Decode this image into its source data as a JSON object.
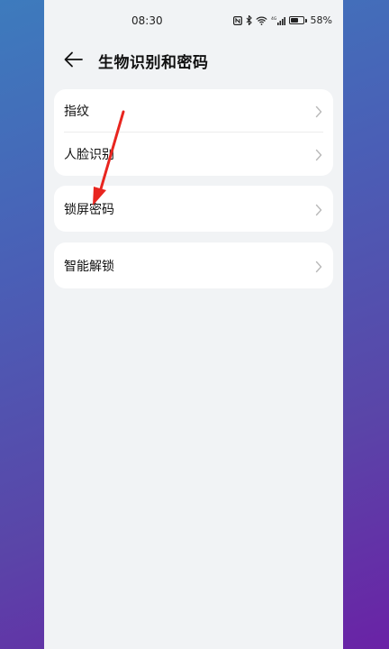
{
  "status_bar": {
    "time": "08:30",
    "battery_percent": "58%",
    "network_label": "4G"
  },
  "header": {
    "title": "生物识别和密码",
    "back_icon": "arrow-left-icon"
  },
  "groups": [
    {
      "items": [
        {
          "label": "指纹"
        },
        {
          "label": "人脸识别"
        }
      ]
    },
    {
      "items": [
        {
          "label": "锁屏密码"
        }
      ]
    },
    {
      "items": [
        {
          "label": "智能解锁"
        }
      ]
    }
  ],
  "colors": {
    "screen_background": "#f1f3f5",
    "card_background": "#ffffff",
    "annotation_arrow": "#e8251f"
  }
}
